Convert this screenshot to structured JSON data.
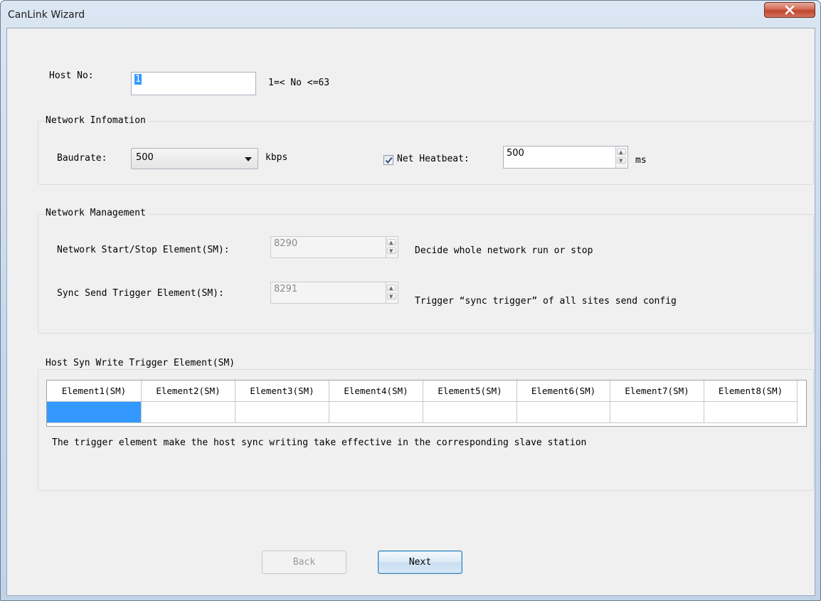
{
  "window": {
    "title": "CanLink Wizard",
    "close_icon": "close-icon",
    "accent_color": "#c2462f"
  },
  "host": {
    "label": "Host No:",
    "value": "1",
    "range_hint": "1=< No <=63"
  },
  "network_info": {
    "title": "Network Infomation",
    "baudrate_label": "Baudrate:",
    "baudrate_value": "500",
    "baudrate_unit": "kbps",
    "heartbeat_checked": true,
    "heartbeat_label": "Net Heatbeat:",
    "heartbeat_value": "500",
    "heartbeat_unit": "ms"
  },
  "network_mgmt": {
    "title": "Network Management",
    "start_stop_label": "Network Start/Stop Element(SM):",
    "start_stop_value": "8290",
    "start_stop_desc": "Decide whole network run or stop",
    "sync_send_label": "Sync Send Trigger Element(SM):",
    "sync_send_value": "8291",
    "sync_send_desc": "Trigger “sync trigger” of all sites send config"
  },
  "host_syn": {
    "title": "Host Syn Write Trigger Element(SM)",
    "columns": [
      "Element1(SM)",
      "Element2(SM)",
      "Element3(SM)",
      "Element4(SM)",
      "Element5(SM)",
      "Element6(SM)",
      "Element7(SM)",
      "Element8(SM)"
    ],
    "rows": [
      [
        "",
        "",
        "",
        "",
        "",
        "",
        "",
        ""
      ]
    ],
    "selected_color": "#3399ff",
    "description": "The trigger element make the host sync writing take effective in the corresponding slave station"
  },
  "buttons": {
    "back": "Back",
    "next": "Next"
  }
}
